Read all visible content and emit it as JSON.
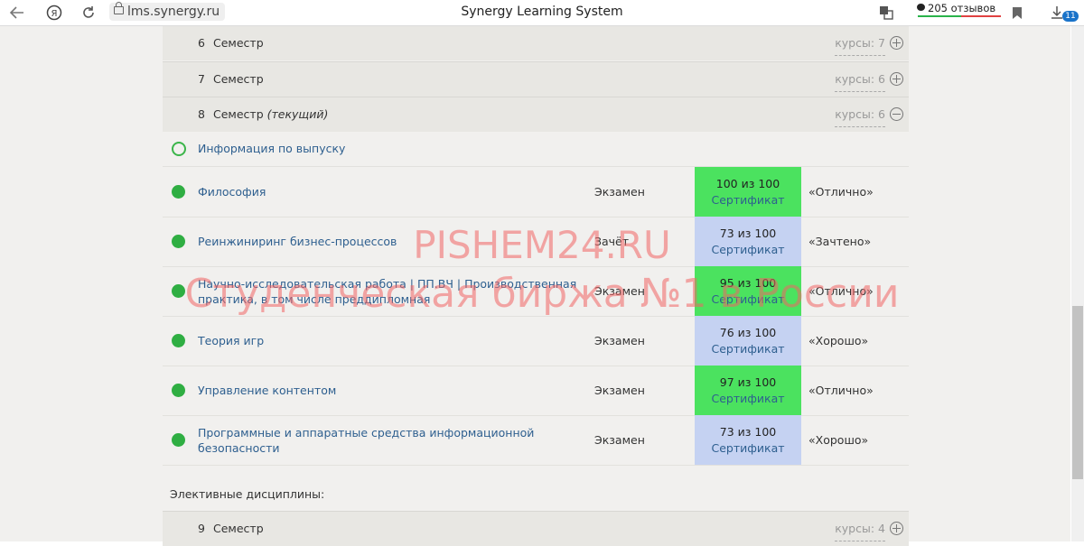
{
  "browser": {
    "url": "lms.synergy.ru",
    "title": "Synergy Learning System",
    "reviews_label": "205 отзывов",
    "downloads_badge": "11"
  },
  "semesters_top": [
    {
      "num": "6",
      "label": "Семестр",
      "current": "",
      "courses": "курсы: 7",
      "expanded": false
    },
    {
      "num": "7",
      "label": "Семестр",
      "current": "",
      "courses": "курсы: 6",
      "expanded": false
    },
    {
      "num": "8",
      "label": "Семестр",
      "current": "(текущий)",
      "courses": "курсы: 6",
      "expanded": true
    }
  ],
  "graduation_info": "Информация по выпуску",
  "courses": [
    {
      "name": "Философия",
      "type": "Экзамен",
      "score": "100 из 100",
      "cert": "Сертификат",
      "grade": "«Отлично»",
      "color": "#4be25f"
    },
    {
      "name": "Реинжиниринг бизнес-процессов",
      "type": "Зачёт",
      "score": "73 из 100",
      "cert": "Сертификат",
      "grade": "«Зачтено»",
      "color": "#c5d2f2"
    },
    {
      "name": "Научно-исследовательская работа | ПП.ВЧ | Производственная практика, в том числе преддипломная",
      "type": "Экзамен",
      "score": "95 из 100",
      "cert": "Сертификат",
      "grade": "«Отлично»",
      "color": "#4be25f"
    },
    {
      "name": "Теория игр",
      "type": "Экзамен",
      "score": "76 из 100",
      "cert": "Сертификат",
      "grade": "«Хорошо»",
      "color": "#c5d2f2"
    },
    {
      "name": "Управление контентом",
      "type": "Экзамен",
      "score": "97 из 100",
      "cert": "Сертификат",
      "grade": "«Отлично»",
      "color": "#4be25f"
    },
    {
      "name": "Программные и аппаратные средства информационной безопасности",
      "type": "Экзамен",
      "score": "73 из 100",
      "cert": "Сертификат",
      "grade": "«Хорошо»",
      "color": "#c5d2f2"
    }
  ],
  "electives_label": "Элективные дисциплины:",
  "semester_bottom": {
    "num": "9",
    "label": "Семестр",
    "courses": "курсы: 4",
    "expanded": false
  },
  "watermark": {
    "line1": "PISHEM24.RU",
    "line2": "Студенческая биржа №1 в России"
  }
}
